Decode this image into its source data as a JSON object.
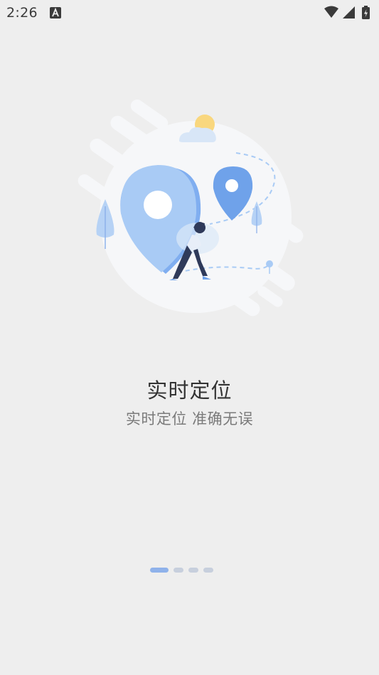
{
  "status_bar": {
    "time": "2:26",
    "notification_icon": "a-letter-icon",
    "icons": [
      "wifi-icon",
      "signal-icon",
      "battery-charging-icon"
    ]
  },
  "onboarding": {
    "title": "实时定位",
    "subtitle": "实时定位 准确无误",
    "page_count": 4,
    "active_page": 1
  },
  "colors": {
    "background": "#eeeeee",
    "accent": "#8fb2ea",
    "pin_light": "#a9cbf5",
    "pin_dark": "#6fa2ea"
  }
}
